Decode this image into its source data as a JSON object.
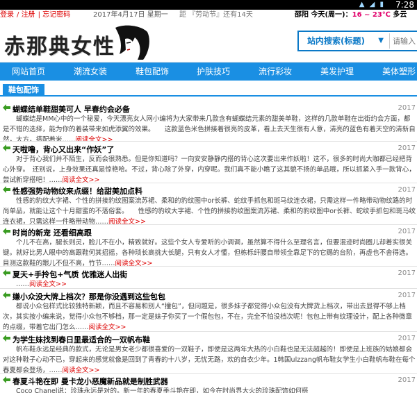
{
  "status": {
    "time": "7:28"
  },
  "topbar": {
    "links": [
      "登录",
      "注册",
      "忘记密码"
    ],
    "date": "2017年4月17日 星期一",
    "countdown": "距 『劳动节』还有14天",
    "city": "邵阳",
    "today": "今天(周一)：",
    "temp": "16 ~ 23℃",
    "weather": "多云"
  },
  "header": {
    "logo_title": "赤那典女性",
    "search_select": "站内搜索(标题)",
    "search_placeholder": "请输入"
  },
  "nav": {
    "items": [
      "网站首页",
      "潮流女装",
      "鞋包配饰",
      "护肤技巧",
      "流行彩妆",
      "美发护理",
      "美体塑形"
    ]
  },
  "section": {
    "label": "鞋包配饰",
    "more_label": "阅读全文>>",
    "articles": [
      {
        "title": "蝴蝶结单鞋甜美可人 早春约会必备",
        "date": "2017",
        "summary": "蝴蝶结是MM心中的一个秘爱，今天漂亮女人网小编将为大家带来几款含有蝴蝶结元素的甜美单鞋，这样的几款单鞋在出街约会方面，都是不错的选择，能为你的着装带来如虎添翼的效果。　　这款蓝色米色拼接着很亮的皮革，看上去天生很有人意，清亮的蓝色有着天空的清新自然，大方，搭配着米……",
        "more": "阅读全文>>"
      },
      {
        "title": "天啦噜，背心又出来“作妖”了",
        "date": "2017",
        "summary": "对于背心我们并不陌生，反而会很熟悉。但是你知道吗？一向安安静静内搭的背心这次要出来作妖啦！这不，很多的时尚大咖都已经把背心外穿。　还别说，上身效果还真是惊艳哈。不过，背心除了外穿，内穿呢。我们真不能小瞧了这其貌不扬的单品哦，所以抓紧入手一款背心，尝试新穿搭吧！……",
        "more": "阅读全文>>"
      },
      {
        "title": "性感强势动物纹来点缀！给甜美加点料",
        "date": "2017",
        "summary": "性感的豹纹大字裙、个性的拼接豹纹图案流苏裙、柔和的豹纹图中or长裤、蛇纹手抓包和斑马纹连衣裙，只需这样一件略带动物纹路的时尚单品，就能让这个十月甜蜜的不落俗套。　　性感的豹纹大字裙、个性的拼接豹纹图案流苏裙、柔和的豹纹图中or长裤、蛇纹手抓包和斑马纹连衣裙，只需这样一件略带动物……",
        "more": "阅读全文>>"
      },
      {
        "title": "时尚的新宠 还看细高跟",
        "date": "2017",
        "summary": "个儿不在高，腿长则灵，脸儿不在小，精致就好。这些个女人专爱听的小调调，虽然算不得什么至理名言，但要混迹时尚圈儿却着实很关键。就好比男人眼中的高跟鞋何其招摇，各种琐长高挑大长腿，只有女人才懂，但栋栎纤腰自带领全靠足下的它赐的台阶，再虚也不舍得选。目测这款鞋的跟儿不但不高，竹节……",
        "more": "阅读全文>>"
      },
      {
        "title": "夏天+手拎包+气质 优雅迷人出街",
        "date": "2017",
        "summary": "……",
        "more": "阅读全文>>"
      },
      {
        "title": "嫌小众没大牌上档次？那是你没遇到这些包包",
        "date": "2017",
        "summary": "都说小众包样式比较独特新颖，而且不容易和别人“撞包”，但问题是，很多妹子都觉得小众包没有大牌货上档次，带出去显得不够上档次，其实按小编来说，觉得小众包不够档，那一定是妹子你买了一个假包包，不在，完全不怕没档次呢！包包上带有纹理设计，配上各种微章的点缀，带着它出门怎么……",
        "more": "阅读全文>>"
      },
      {
        "title": "为学生妹找到春日里最适合的一双帆布鞋",
        "date": "2017",
        "summary": "帆布鞋永远是经典的款式，无论是男女老少都很喜爱的一双鞋子，即使是这两年大热的小白鞋也是无法超越的！即使是上班族的姑娘都会对这种鞋子心动不已，穿起来的感觉就像是回到了青春的十八岁，无忧无路，欢的自衣少年。1韩国ulzzang帆布鞋女学生小白鞋帆布鞋在每个春夏都会登场，……",
        "more": "阅读全文>>"
      },
      {
        "title": "春夏斗艳在即 曼卡龙小恶魔新品就是制胜武器",
        "date": "2017",
        "summary": "Coco Chanel说：珍珠永远是对的。新一年的春夏季斗艳在即，如今在时尚界大火的珍珠配饰如何搭",
        "more": ""
      }
    ]
  },
  "colors": {
    "nav_blue": "#1a8fe3",
    "link_red": "#d00000",
    "temp_pink": "#e0006a"
  }
}
